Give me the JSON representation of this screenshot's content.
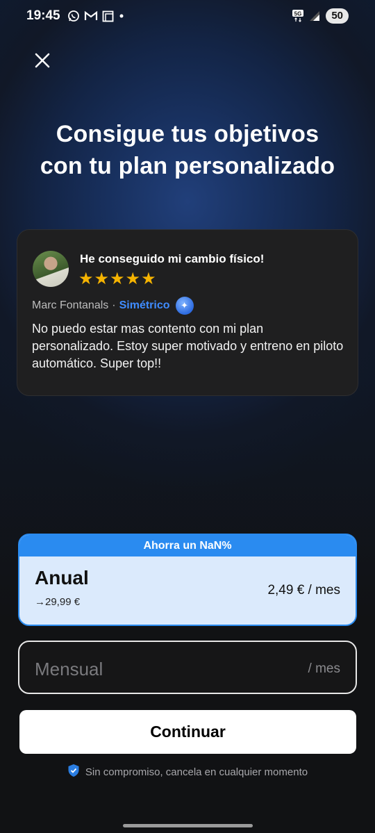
{
  "status_bar": {
    "time": "19:45",
    "network": "5G",
    "battery": "50",
    "icons": [
      "whatsapp-icon",
      "gmail-icon",
      "screenshot-icon",
      "dot-icon"
    ]
  },
  "header": {
    "title_line1": "Consigue tus objetivos",
    "title_line2": "con tu plan personalizado"
  },
  "review": {
    "title": "He conseguido mi cambio físico!",
    "stars": "★★★★★",
    "rating": 5,
    "author": "Marc Fontanals",
    "separator": "·",
    "tag": "Simétrico",
    "body": "No puedo estar mas contento con mi plan personalizado. Estoy super motivado y entreno en piloto automático.  Super top!!"
  },
  "plans": {
    "annual": {
      "banner": "Ahorra un NaN%",
      "name": "Anual",
      "subtitle": "→29,99 €",
      "price": "2,49 € / mes"
    },
    "monthly": {
      "name": "Mensual",
      "price": "/ mes"
    }
  },
  "actions": {
    "continue_label": "Continuar",
    "footnote": "Sin compromiso, cancela en cualquier momento"
  },
  "colors": {
    "accent": "#2a8bf0",
    "star": "#f5b301",
    "tag": "#3f8cff",
    "background": "#111214"
  }
}
